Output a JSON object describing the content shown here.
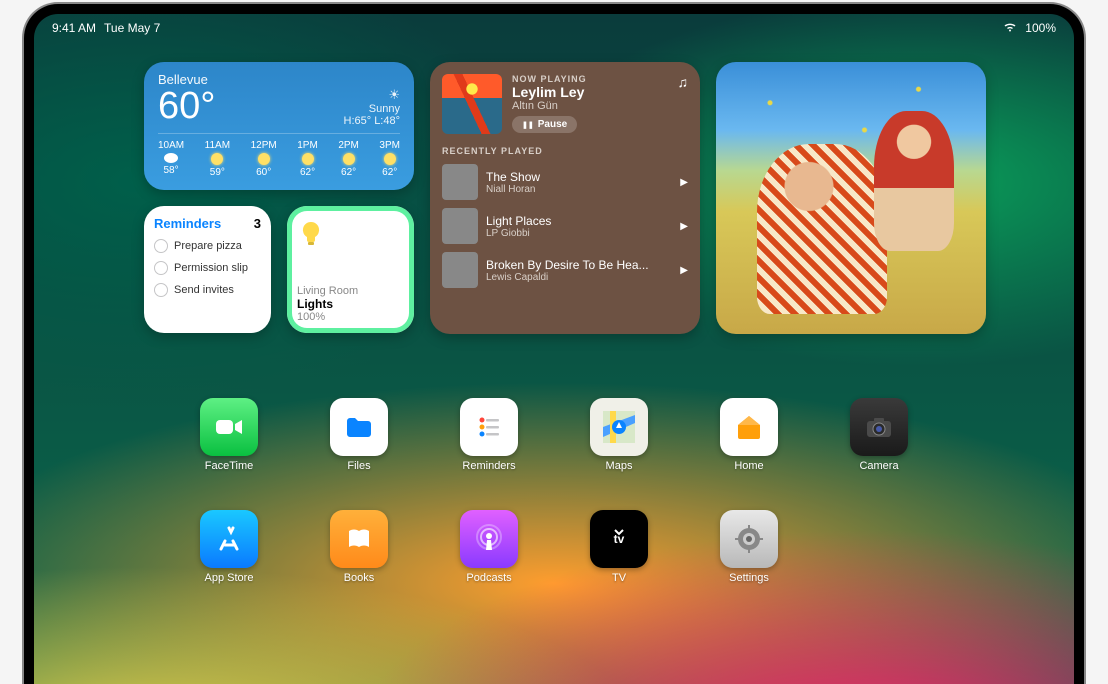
{
  "statusbar": {
    "time": "9:41 AM",
    "date": "Tue May 7",
    "battery": "100%"
  },
  "widgets": {
    "weather": {
      "location": "Bellevue",
      "temp": "60°",
      "condition": "Sunny",
      "hilo": "H:65° L:48°",
      "hourly": [
        {
          "t": "10AM",
          "tp": "58°",
          "s": "cloud"
        },
        {
          "t": "11AM",
          "tp": "59°",
          "s": "sun"
        },
        {
          "t": "12PM",
          "tp": "60°",
          "s": "sun"
        },
        {
          "t": "1PM",
          "tp": "62°",
          "s": "sun"
        },
        {
          "t": "2PM",
          "tp": "62°",
          "s": "sun"
        },
        {
          "t": "3PM",
          "tp": "62°",
          "s": "sun"
        }
      ]
    },
    "reminders": {
      "title": "Reminders",
      "count": "3",
      "items": [
        "Prepare pizza",
        "Permission slip",
        "Send invites"
      ]
    },
    "home": {
      "room": "Living Room",
      "device": "Lights",
      "level": "100%"
    },
    "music": {
      "now_label": "NOW PLAYING",
      "title": "Leylim Ley",
      "artist": "Altın Gün",
      "pause": "Pause",
      "recent_label": "RECENTLY PLAYED",
      "tracks": [
        {
          "title": "The Show",
          "artist": "Niall Horan"
        },
        {
          "title": "Light Places",
          "artist": "LP Giobbi"
        },
        {
          "title": "Broken By Desire To Be Hea...",
          "artist": "Lewis Capaldi"
        }
      ]
    }
  },
  "apps": {
    "row": [
      "FaceTime",
      "Files",
      "Reminders",
      "Maps",
      "Home",
      "Camera",
      "App Store",
      "Books",
      "Podcasts",
      "TV",
      "Settings"
    ]
  }
}
